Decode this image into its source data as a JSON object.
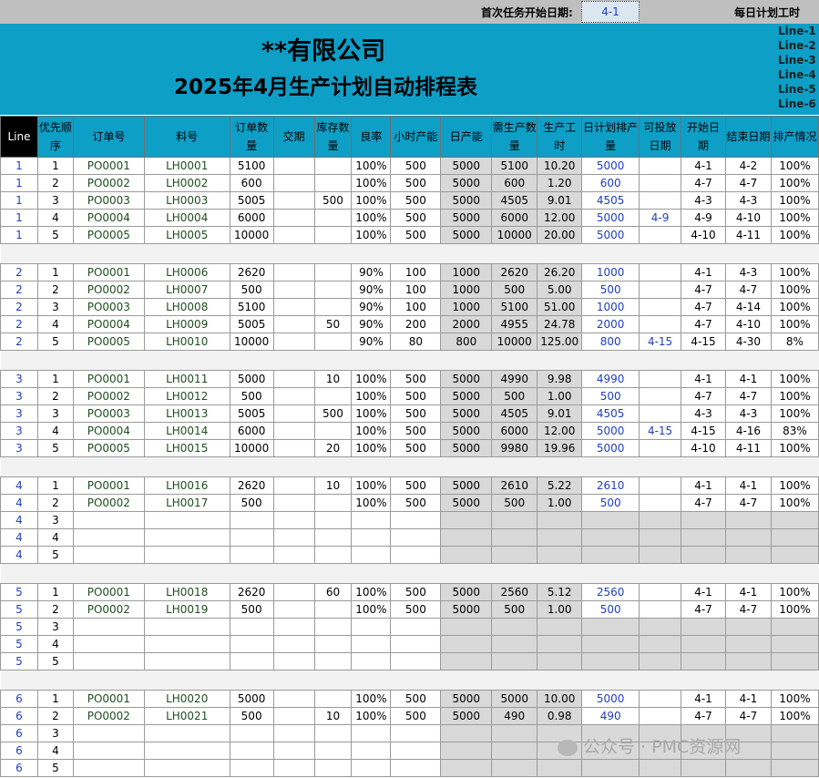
{
  "top": {
    "start_label": "首次任务开始日期:",
    "start_value": "4-1",
    "daily_label": "每日计划工时"
  },
  "header": {
    "company": "**有限公司",
    "title": "2025年4月生产计划自动排程表",
    "lines": [
      "Line-1",
      "Line-2",
      "Line-3",
      "Line-4",
      "Line-5",
      "Line-6"
    ]
  },
  "columns": [
    "Line",
    "优先顺序",
    "订单号",
    "料号",
    "订单数量",
    "交期",
    "库存数量",
    "良率",
    "小时产能",
    "日产能",
    "需生产数量",
    "生产工时",
    "日计划排产量",
    "可投放日期",
    "开始日期",
    "结束日期",
    "排产情况"
  ],
  "groups": [
    {
      "rows": [
        [
          "1",
          "1",
          "PO0001",
          "LH0001",
          "5100",
          "",
          "",
          "100%",
          "500",
          "5000",
          "5100",
          "10.20",
          "5000",
          "",
          "4-1",
          "4-2",
          "100%"
        ],
        [
          "1",
          "2",
          "PO0002",
          "LH0002",
          "600",
          "",
          "",
          "100%",
          "500",
          "5000",
          "600",
          "1.20",
          "600",
          "",
          "4-7",
          "4-7",
          "100%"
        ],
        [
          "1",
          "3",
          "PO0003",
          "LH0003",
          "5005",
          "",
          "500",
          "100%",
          "500",
          "5000",
          "4505",
          "9.01",
          "4505",
          "",
          "4-3",
          "4-3",
          "100%"
        ],
        [
          "1",
          "4",
          "PO0004",
          "LH0004",
          "6000",
          "",
          "",
          "100%",
          "500",
          "5000",
          "6000",
          "12.00",
          "5000",
          "4-9",
          "4-9",
          "4-10",
          "100%"
        ],
        [
          "1",
          "5",
          "PO0005",
          "LH0005",
          "10000",
          "",
          "",
          "100%",
          "500",
          "5000",
          "10000",
          "20.00",
          "5000",
          "",
          "4-10",
          "4-11",
          "100%"
        ]
      ]
    },
    {
      "rows": [
        [
          "2",
          "1",
          "PO0001",
          "LH0006",
          "2620",
          "",
          "",
          "90%",
          "100",
          "1000",
          "2620",
          "26.20",
          "1000",
          "",
          "4-1",
          "4-3",
          "100%"
        ],
        [
          "2",
          "2",
          "PO0002",
          "LH0007",
          "500",
          "",
          "",
          "90%",
          "100",
          "1000",
          "500",
          "5.00",
          "500",
          "",
          "4-7",
          "4-7",
          "100%"
        ],
        [
          "2",
          "3",
          "PO0003",
          "LH0008",
          "5100",
          "",
          "",
          "90%",
          "100",
          "1000",
          "5100",
          "51.00",
          "1000",
          "",
          "4-7",
          "4-14",
          "100%"
        ],
        [
          "2",
          "4",
          "PO0004",
          "LH0009",
          "5005",
          "",
          "50",
          "90%",
          "200",
          "2000",
          "4955",
          "24.78",
          "2000",
          "",
          "4-7",
          "4-10",
          "100%"
        ],
        [
          "2",
          "5",
          "PO0005",
          "LH0010",
          "10000",
          "",
          "",
          "90%",
          "80",
          "800",
          "10000",
          "125.00",
          "800",
          "4-15",
          "4-15",
          "4-30",
          "8%"
        ]
      ]
    },
    {
      "rows": [
        [
          "3",
          "1",
          "PO0001",
          "LH0011",
          "5000",
          "",
          "10",
          "100%",
          "500",
          "5000",
          "4990",
          "9.98",
          "4990",
          "",
          "4-1",
          "4-1",
          "100%"
        ],
        [
          "3",
          "2",
          "PO0002",
          "LH0012",
          "500",
          "",
          "",
          "100%",
          "500",
          "5000",
          "500",
          "1.00",
          "500",
          "",
          "4-7",
          "4-7",
          "100%"
        ],
        [
          "3",
          "3",
          "PO0003",
          "LH0013",
          "5005",
          "",
          "500",
          "100%",
          "500",
          "5000",
          "4505",
          "9.01",
          "4505",
          "",
          "4-3",
          "4-3",
          "100%"
        ],
        [
          "3",
          "4",
          "PO0004",
          "LH0014",
          "6000",
          "",
          "",
          "100%",
          "500",
          "5000",
          "6000",
          "12.00",
          "5000",
          "4-15",
          "4-15",
          "4-16",
          "83%"
        ],
        [
          "3",
          "5",
          "PO0005",
          "LH0015",
          "10000",
          "",
          "20",
          "100%",
          "500",
          "5000",
          "9980",
          "19.96",
          "5000",
          "",
          "4-10",
          "4-11",
          "100%"
        ]
      ]
    },
    {
      "rows": [
        [
          "4",
          "1",
          "PO0001",
          "LH0016",
          "2620",
          "",
          "10",
          "100%",
          "500",
          "5000",
          "2610",
          "5.22",
          "2610",
          "",
          "4-1",
          "4-1",
          "100%"
        ],
        [
          "4",
          "2",
          "PO0002",
          "LH0017",
          "500",
          "",
          "",
          "100%",
          "500",
          "5000",
          "500",
          "1.00",
          "500",
          "",
          "4-7",
          "4-7",
          "100%"
        ],
        [
          "4",
          "3",
          "",
          "",
          "",
          "",
          "",
          "",
          "",
          "",
          "",
          "",
          "",
          "",
          "",
          "",
          ""
        ],
        [
          "4",
          "4",
          "",
          "",
          "",
          "",
          "",
          "",
          "",
          "",
          "",
          "",
          "",
          "",
          "",
          "",
          ""
        ],
        [
          "4",
          "5",
          "",
          "",
          "",
          "",
          "",
          "",
          "",
          "",
          "",
          "",
          "",
          "",
          "",
          "",
          ""
        ]
      ]
    },
    {
      "rows": [
        [
          "5",
          "1",
          "PO0001",
          "LH0018",
          "2620",
          "",
          "60",
          "100%",
          "500",
          "5000",
          "2560",
          "5.12",
          "2560",
          "",
          "4-1",
          "4-1",
          "100%"
        ],
        [
          "5",
          "2",
          "PO0002",
          "LH0019",
          "500",
          "",
          "",
          "100%",
          "500",
          "5000",
          "500",
          "1.00",
          "500",
          "",
          "4-7",
          "4-7",
          "100%"
        ],
        [
          "5",
          "3",
          "",
          "",
          "",
          "",
          "",
          "",
          "",
          "",
          "",
          "",
          "",
          "",
          "",
          "",
          ""
        ],
        [
          "5",
          "4",
          "",
          "",
          "",
          "",
          "",
          "",
          "",
          "",
          "",
          "",
          "",
          "",
          "",
          "",
          ""
        ],
        [
          "5",
          "5",
          "",
          "",
          "",
          "",
          "",
          "",
          "",
          "",
          "",
          "",
          "",
          "",
          "",
          "",
          ""
        ]
      ]
    },
    {
      "rows": [
        [
          "6",
          "1",
          "PO0001",
          "LH0020",
          "5000",
          "",
          "",
          "100%",
          "500",
          "5000",
          "5000",
          "10.00",
          "5000",
          "",
          "4-1",
          "4-1",
          "100%"
        ],
        [
          "6",
          "2",
          "PO0002",
          "LH0021",
          "500",
          "",
          "10",
          "100%",
          "500",
          "5000",
          "490",
          "0.98",
          "490",
          "",
          "4-7",
          "4-7",
          "100%"
        ],
        [
          "6",
          "3",
          "",
          "",
          "",
          "",
          "",
          "",
          "",
          "",
          "",
          "",
          "",
          "",
          "",
          "",
          ""
        ],
        [
          "6",
          "4",
          "",
          "",
          "",
          "",
          "",
          "",
          "",
          "",
          "",
          "",
          "",
          "",
          "",
          "",
          ""
        ],
        [
          "6",
          "5",
          "",
          "",
          "",
          "",
          "",
          "",
          "",
          "",
          "",
          "",
          "",
          "",
          "",
          "",
          ""
        ]
      ]
    }
  ],
  "watermark": "公众号 · PMC资源网"
}
